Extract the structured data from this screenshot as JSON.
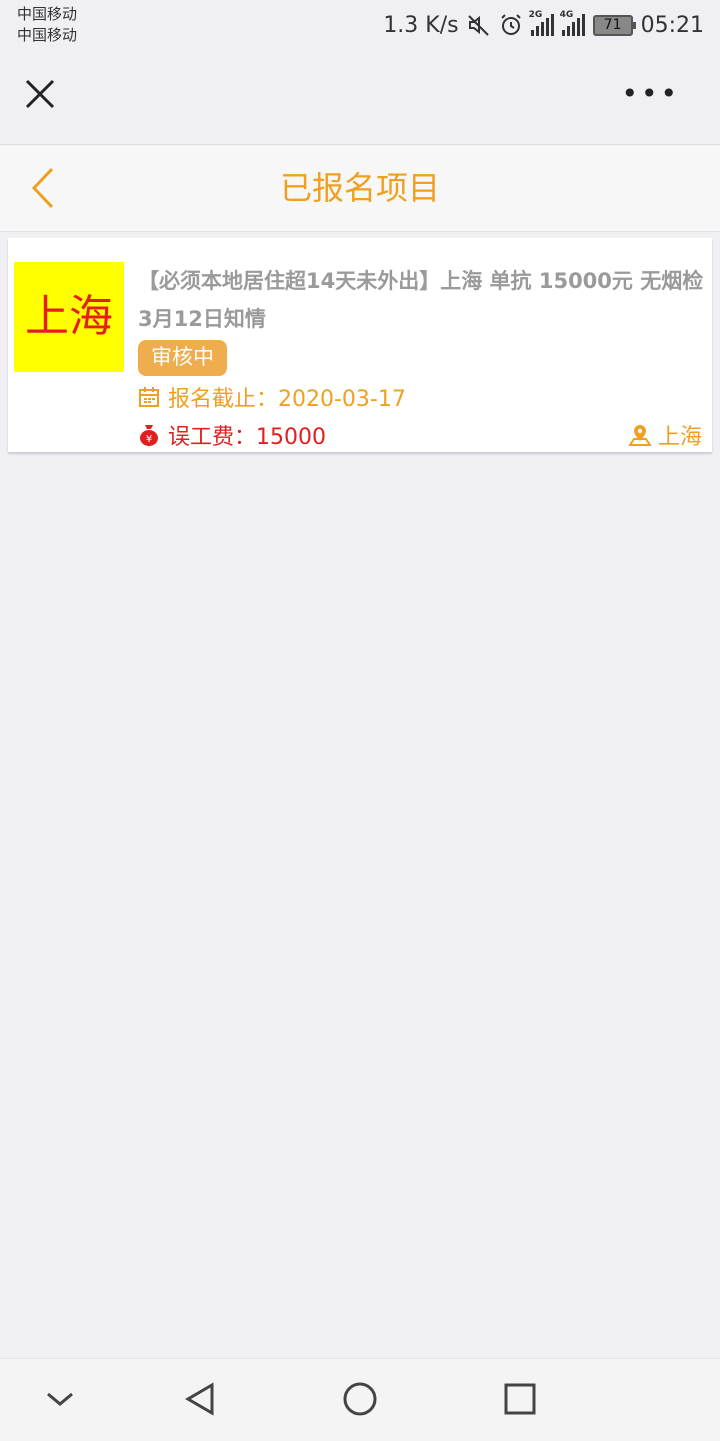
{
  "status": {
    "carrier1": "中国移动",
    "carrier2": "中国移动",
    "speed": "1.3 K/s",
    "net1": "2G",
    "net2": "4G",
    "battery": "71",
    "time": "05:21"
  },
  "header": {
    "title": "已报名项目"
  },
  "project": {
    "thumb_text": "上海",
    "title": "【必须本地居住超14天未外出】上海 单抗 15000元 无烟检 3月12日知情",
    "status": "审核中",
    "deadline": "报名截止：2020-03-17",
    "fee": "误工费：15000",
    "location": "上海"
  },
  "colors": {
    "accent": "#f0a020",
    "badge": "#f0ad4e",
    "fee": "#e02020",
    "thumb_bg": "#ffff00"
  }
}
